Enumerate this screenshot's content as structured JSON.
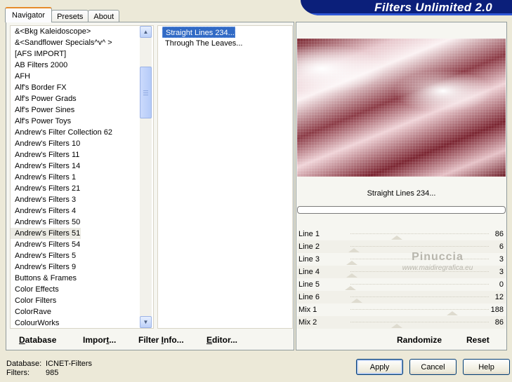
{
  "app": {
    "title": "Filters Unlimited 2.0"
  },
  "tabs": [
    {
      "label": "Navigator",
      "active": true
    },
    {
      "label": "Presets",
      "active": false
    },
    {
      "label": "About",
      "active": false
    }
  ],
  "categories": {
    "selected_index": 18,
    "items": [
      "&<Bkg Kaleidoscope>",
      "&<Sandflower Specials^v^ >",
      "[AFS IMPORT]",
      "AB Filters 2000",
      "AFH",
      "Alf's Border FX",
      "Alf's Power Grads",
      "Alf's Power Sines",
      "Alf's Power Toys",
      "Andrew's Filter Collection 62",
      "Andrew's Filters 10",
      "Andrew's Filters 11",
      "Andrew's Filters 14",
      "Andrew's Filters 1",
      "Andrew's Filters 21",
      "Andrew's Filters 3",
      "Andrew's Filters 4",
      "Andrew's Filters 50",
      "Andrew's Filters 51",
      "Andrew's Filters 54",
      "Andrew's Filters 5",
      "Andrew's Filters 9",
      "Buttons & Frames",
      "Color Effects",
      "Color Filters",
      "ColorRave",
      "ColourWorks"
    ]
  },
  "filters": {
    "items": [
      {
        "label": "Straight Lines 234...",
        "selected": true
      },
      {
        "label": "Through The Leaves...",
        "selected": false
      }
    ]
  },
  "bottom_links": {
    "database": {
      "underlined": "D",
      "rest": "atabase"
    },
    "import": {
      "pre": "Impor",
      "underlined": "t",
      "rest": "..."
    },
    "filter_info": {
      "pre": "Filter ",
      "underlined": "I",
      "rest": "nfo..."
    },
    "editor": {
      "underlined": "E",
      "rest": "ditor..."
    }
  },
  "preview": {
    "filter_name": "Straight Lines 234...",
    "progress_percent": 0
  },
  "params": [
    {
      "label": "Line 1",
      "value": "86",
      "fraction": 0.337
    },
    {
      "label": "Line 2",
      "value": "6",
      "fraction": 0.024
    },
    {
      "label": "Line 3",
      "value": "3",
      "fraction": 0.012
    },
    {
      "label": "Line 4",
      "value": "3",
      "fraction": 0.012
    },
    {
      "label": "Line 5",
      "value": "0",
      "fraction": 0.0
    },
    {
      "label": "Line 6",
      "value": "12",
      "fraction": 0.047
    },
    {
      "label": "Mix 1",
      "value": "188",
      "fraction": 0.737
    },
    {
      "label": "Mix 2",
      "value": "86",
      "fraction": 0.337
    }
  ],
  "watermark": {
    "line1": "Pinuccia",
    "line2": "www.maidiregrafica.eu"
  },
  "right_links": {
    "randomize": "Randomize",
    "reset": "Reset"
  },
  "footer": {
    "database_label": "Database:",
    "database_value": "ICNET-Filters",
    "filters_label": "Filters:",
    "filters_value": "985"
  },
  "buttons": {
    "apply": "Apply",
    "cancel": "Cancel",
    "help": "Help"
  }
}
